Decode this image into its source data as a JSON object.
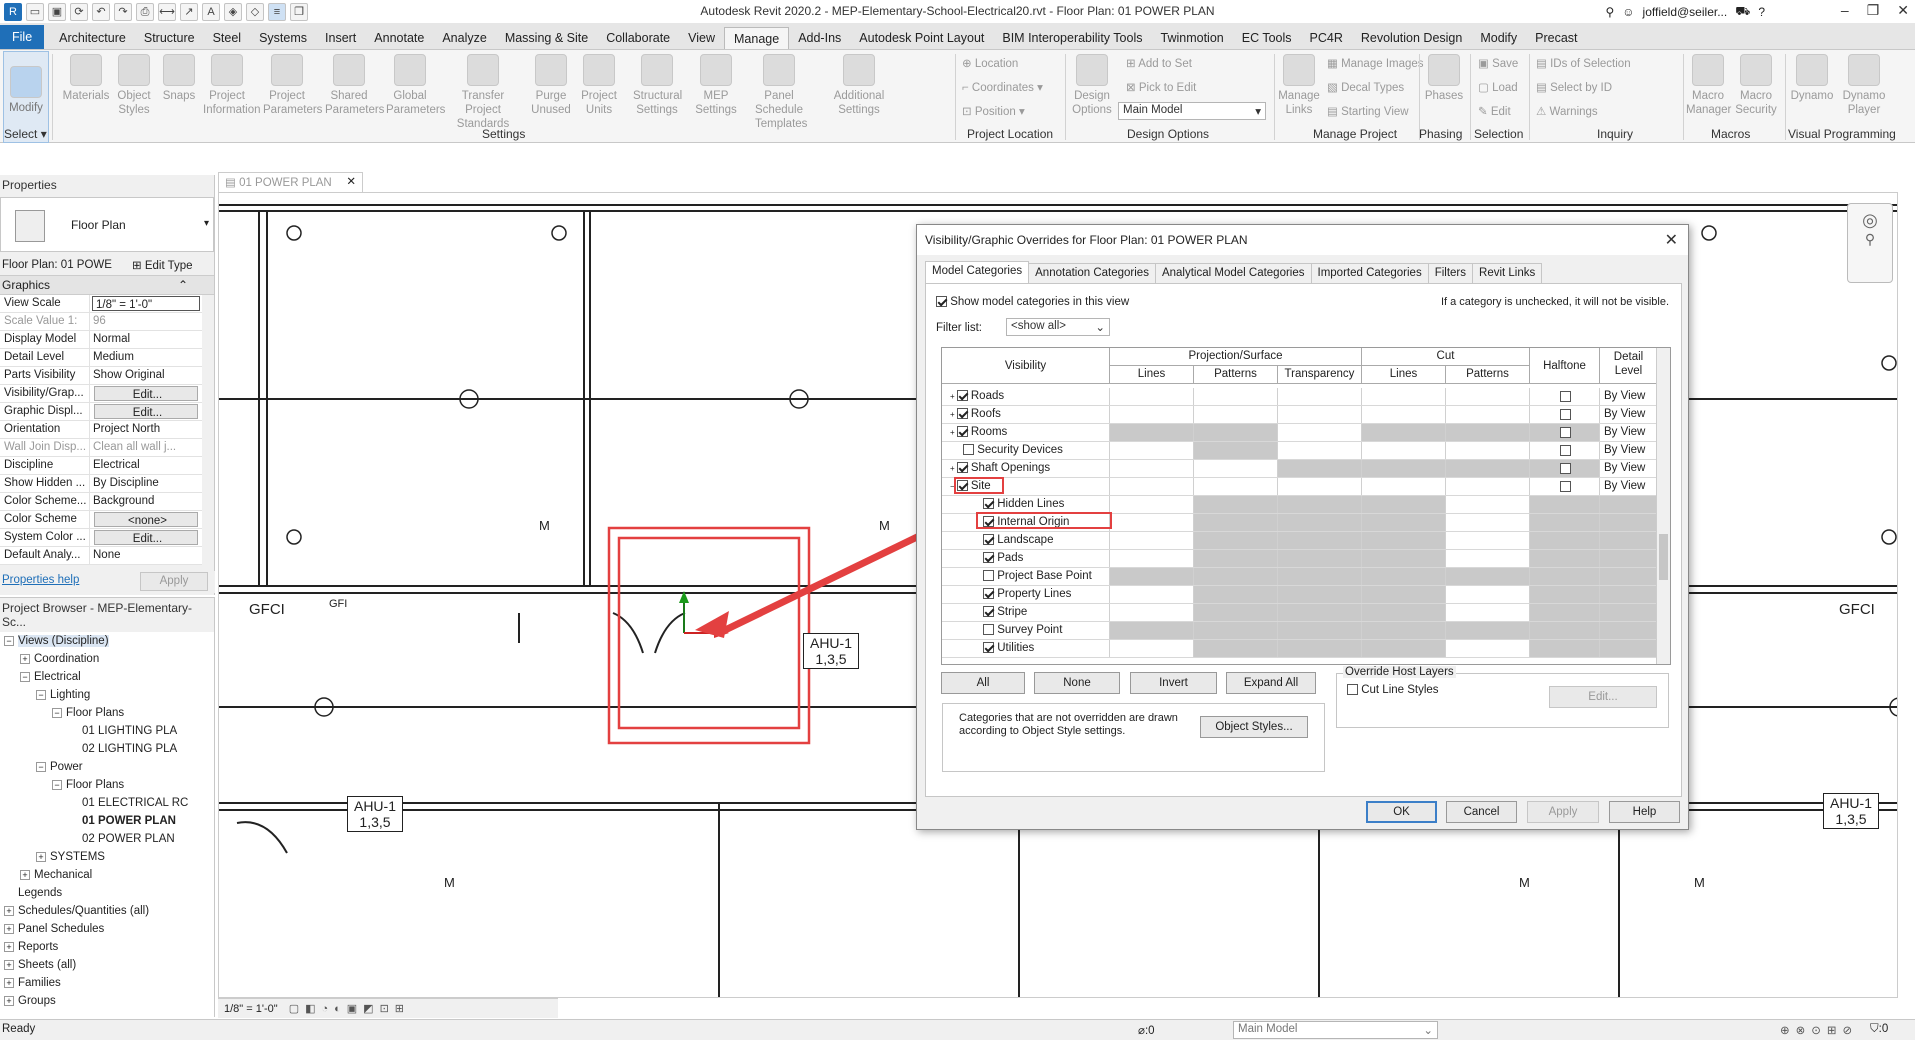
{
  "window": {
    "title": "Autodesk Revit 2020.2 - MEP-Elementary-School-Electrical20.rvt - Floor Plan: 01 POWER PLAN",
    "user": "joffield@seiler...",
    "help": "?"
  },
  "ribbon_tabs": [
    "File",
    "Architecture",
    "Structure",
    "Steel",
    "Systems",
    "Insert",
    "Annotate",
    "Analyze",
    "Massing & Site",
    "Collaborate",
    "View",
    "Manage",
    "Add-Ins",
    "Autodesk Point Layout",
    "BIM Interoperability Tools",
    "Twinmotion",
    "EC Tools",
    "PC4R",
    "Revolution Design",
    "Modify",
    "Precast"
  ],
  "ribbon_active_tab": "Manage",
  "ribbon": {
    "modify": "Modify",
    "select": "Select",
    "settings_buttons": [
      "Materials",
      "Object Styles",
      "Snaps",
      "Project Information",
      "Project Parameters",
      "Shared Parameters",
      "Global Parameters",
      "Transfer Project Standards",
      "Purge Unused",
      "Project Units",
      "Structural Settings",
      "MEP Settings",
      "Panel Schedule Templates",
      "Additional Settings"
    ],
    "settings_label": "Settings",
    "location_items": [
      "Location",
      "Coordinates",
      "Position"
    ],
    "location_label": "Project Location",
    "design_options": "Design Options",
    "add_to_set": "Add to Set",
    "pick_to_edit": "Pick to Edit",
    "main_model": "Main Model",
    "design_options_label": "Design Options",
    "manage_links": "Manage Links",
    "manage_images": "Manage Images",
    "decal_types": "Decal Types",
    "starting_view": "Starting View",
    "manage_project_label": "Manage Project",
    "phases": "Phases",
    "phasing_label": "Phasing",
    "save": "Save",
    "load": "Load",
    "edit": "Edit",
    "selection_label": "Selection",
    "ids_of_selection": "IDs of Selection",
    "select_by_id": "Select by ID",
    "warnings": "Warnings",
    "inquiry_label": "Inquiry",
    "macro_manager": "Macro Manager",
    "macro_security": "Macro Security",
    "macros_label": "Macros",
    "dynamo": "Dynamo",
    "dynamo_player": "Dynamo Player",
    "visual_programming_label": "Visual Programming"
  },
  "properties": {
    "title": "Properties",
    "type": "Floor Plan",
    "instance": "Floor Plan: 01 POWE",
    "edit_type": "Edit Type",
    "section": "Graphics",
    "rows": [
      {
        "k": "View Scale",
        "v": "1/8\" = 1'-0\"",
        "style": "input"
      },
      {
        "k": "Scale Value    1:",
        "v": "96",
        "style": "gray"
      },
      {
        "k": "Display Model",
        "v": "Normal"
      },
      {
        "k": "Detail Level",
        "v": "Medium"
      },
      {
        "k": "Parts Visibility",
        "v": "Show Original"
      },
      {
        "k": "Visibility/Grap...",
        "v": "Edit...",
        "style": "btn"
      },
      {
        "k": "Graphic Displ...",
        "v": "Edit...",
        "style": "btn"
      },
      {
        "k": "Orientation",
        "v": "Project North"
      },
      {
        "k": "Wall Join Disp...",
        "v": "Clean all wall j...",
        "style": "gray"
      },
      {
        "k": "Discipline",
        "v": "Electrical"
      },
      {
        "k": "Show Hidden ...",
        "v": "By Discipline"
      },
      {
        "k": "Color Scheme...",
        "v": "Background"
      },
      {
        "k": "Color Scheme",
        "v": "<none>",
        "style": "btn"
      },
      {
        "k": "System Color ...",
        "v": "Edit...",
        "style": "btn"
      },
      {
        "k": "Default Analy...",
        "v": "None"
      }
    ],
    "help": "Properties help",
    "apply": "Apply"
  },
  "browser": {
    "title": "Project Browser - MEP-Elementary-Sc...",
    "items": [
      {
        "t": "Views (Discipline)",
        "lvl": 0,
        "exp": "-"
      },
      {
        "t": "Coordination",
        "lvl": 1,
        "exp": "+"
      },
      {
        "t": "Electrical",
        "lvl": 1,
        "exp": "-"
      },
      {
        "t": "Lighting",
        "lvl": 2,
        "exp": "-"
      },
      {
        "t": "Floor Plans",
        "lvl": 3,
        "exp": "-"
      },
      {
        "t": "01 LIGHTING PLA",
        "lvl": 4,
        "exp": ""
      },
      {
        "t": "02 LIGHTING PLA",
        "lvl": 4,
        "exp": ""
      },
      {
        "t": "Power",
        "lvl": 2,
        "exp": "-"
      },
      {
        "t": "Floor Plans",
        "lvl": 3,
        "exp": "-"
      },
      {
        "t": "01 ELECTRICAL RC",
        "lvl": 4,
        "exp": ""
      },
      {
        "t": "01 POWER PLAN",
        "lvl": 4,
        "exp": "",
        "bold": true
      },
      {
        "t": "02 POWER PLAN",
        "lvl": 4,
        "exp": ""
      },
      {
        "t": "SYSTEMS",
        "lvl": 2,
        "exp": "+"
      },
      {
        "t": "Mechanical",
        "lvl": 1,
        "exp": "+"
      },
      {
        "t": "Legends",
        "lvl": 0,
        "exp": ""
      },
      {
        "t": "Schedules/Quantities (all)",
        "lvl": 0,
        "exp": "+"
      },
      {
        "t": "Panel Schedules",
        "lvl": 0,
        "exp": "+"
      },
      {
        "t": "Reports",
        "lvl": 0,
        "exp": "+"
      },
      {
        "t": "Sheets (all)",
        "lvl": 0,
        "exp": "+"
      },
      {
        "t": "Families",
        "lvl": 0,
        "exp": "+"
      },
      {
        "t": "Groups",
        "lvl": 0,
        "exp": "+"
      }
    ]
  },
  "view_tab": "01 POWER PLAN",
  "view_scale_bar": "1/8\" = 1'-0\"",
  "drawing": {
    "ahu_left": [
      "AHU-1",
      "1,3,5"
    ],
    "ahu_center": [
      "AHU-1",
      "1,3,5"
    ],
    "ahu_right": [
      "AHU-1",
      "1,3,5"
    ],
    "gfci": "GFCI",
    "gfi": "GFI",
    "m": "M"
  },
  "dialog": {
    "title": "Visibility/Graphic Overrides for Floor Plan: 01 POWER PLAN",
    "tabs": [
      "Model Categories",
      "Annotation Categories",
      "Analytical Model Categories",
      "Imported Categories",
      "Filters",
      "Revit Links"
    ],
    "show_model": "Show model categories in this view",
    "hint": "If a category is unchecked, it will not be visible.",
    "filter_label": "Filter list:",
    "filter_value": "<show all>",
    "col_visibility": "Visibility",
    "col_projection": "Projection/Surface",
    "col_cut": "Cut",
    "col_halftone": "Halftone",
    "col_detail": "Detail Level",
    "sub_lines": "Lines",
    "sub_patterns": "Patterns",
    "sub_transparency": "Transparency",
    "rows": [
      {
        "name": "Roads",
        "lvl": 0,
        "exp": "+",
        "chk": true,
        "pat": "wwwwww",
        "detail": "By View",
        "ht": true
      },
      {
        "name": "Roofs",
        "lvl": 0,
        "exp": "+",
        "chk": true,
        "pat": "wwwwww",
        "detail": "By View",
        "ht": true
      },
      {
        "name": "Rooms",
        "lvl": 0,
        "exp": "+",
        "chk": true,
        "pat": "ggwggg",
        "detail": "By View",
        "ht": true
      },
      {
        "name": "Security Devices",
        "lvl": 0,
        "exp": "",
        "chk": false,
        "pat": "wgwwww",
        "detail": "By View",
        "ht": true
      },
      {
        "name": "Shaft Openings",
        "lvl": 0,
        "exp": "+",
        "chk": true,
        "pat": "wwgggg",
        "detail": "By View",
        "ht": true
      },
      {
        "name": "Site",
        "lvl": 0,
        "exp": "-",
        "chk": true,
        "pat": "wwwwww",
        "detail": "By View",
        "ht": true
      },
      {
        "name": "Hidden Lines",
        "lvl": 1,
        "exp": "",
        "chk": true,
        "pat": "wgggwg",
        "detail": "",
        "ht": false
      },
      {
        "name": "Internal Origin",
        "lvl": 1,
        "exp": "",
        "chk": true,
        "pat": "wgggwg",
        "detail": "",
        "ht": false
      },
      {
        "name": "Landscape",
        "lvl": 1,
        "exp": "",
        "chk": true,
        "pat": "wgggwg",
        "detail": "",
        "ht": false
      },
      {
        "name": "Pads",
        "lvl": 1,
        "exp": "",
        "chk": true,
        "pat": "wgggwg",
        "detail": "",
        "ht": false
      },
      {
        "name": "Project Base Point",
        "lvl": 1,
        "exp": "",
        "chk": false,
        "pat": "gggggg",
        "detail": "",
        "ht": false
      },
      {
        "name": "Property Lines",
        "lvl": 1,
        "exp": "",
        "chk": true,
        "pat": "wgggwg",
        "detail": "",
        "ht": false
      },
      {
        "name": "Stripe",
        "lvl": 1,
        "exp": "",
        "chk": true,
        "pat": "wgggwg",
        "detail": "",
        "ht": false
      },
      {
        "name": "Survey Point",
        "lvl": 1,
        "exp": "",
        "chk": false,
        "pat": "gggggg",
        "detail": "",
        "ht": false
      },
      {
        "name": "Utilities",
        "lvl": 1,
        "exp": "",
        "chk": true,
        "pat": "wgggwg",
        "detail": "",
        "ht": false
      }
    ],
    "btn_all": "All",
    "btn_none": "None",
    "btn_invert": "Invert",
    "btn_expand": "Expand All",
    "override_group": "Override Host Layers",
    "cut_line_styles": "Cut Line Styles",
    "edit": "Edit...",
    "note": "Categories that are not overridden are drawn according to Object Style settings.",
    "object_styles": "Object Styles...",
    "ok": "OK",
    "cancel": "Cancel",
    "apply": "Apply",
    "help": "Help"
  },
  "status": {
    "ready": "Ready",
    "zero1": ":0",
    "main_model": "Main Model",
    "zero2": ":0"
  },
  "colors": {
    "accent": "#1f6fb8",
    "highlight": "#e34040"
  }
}
